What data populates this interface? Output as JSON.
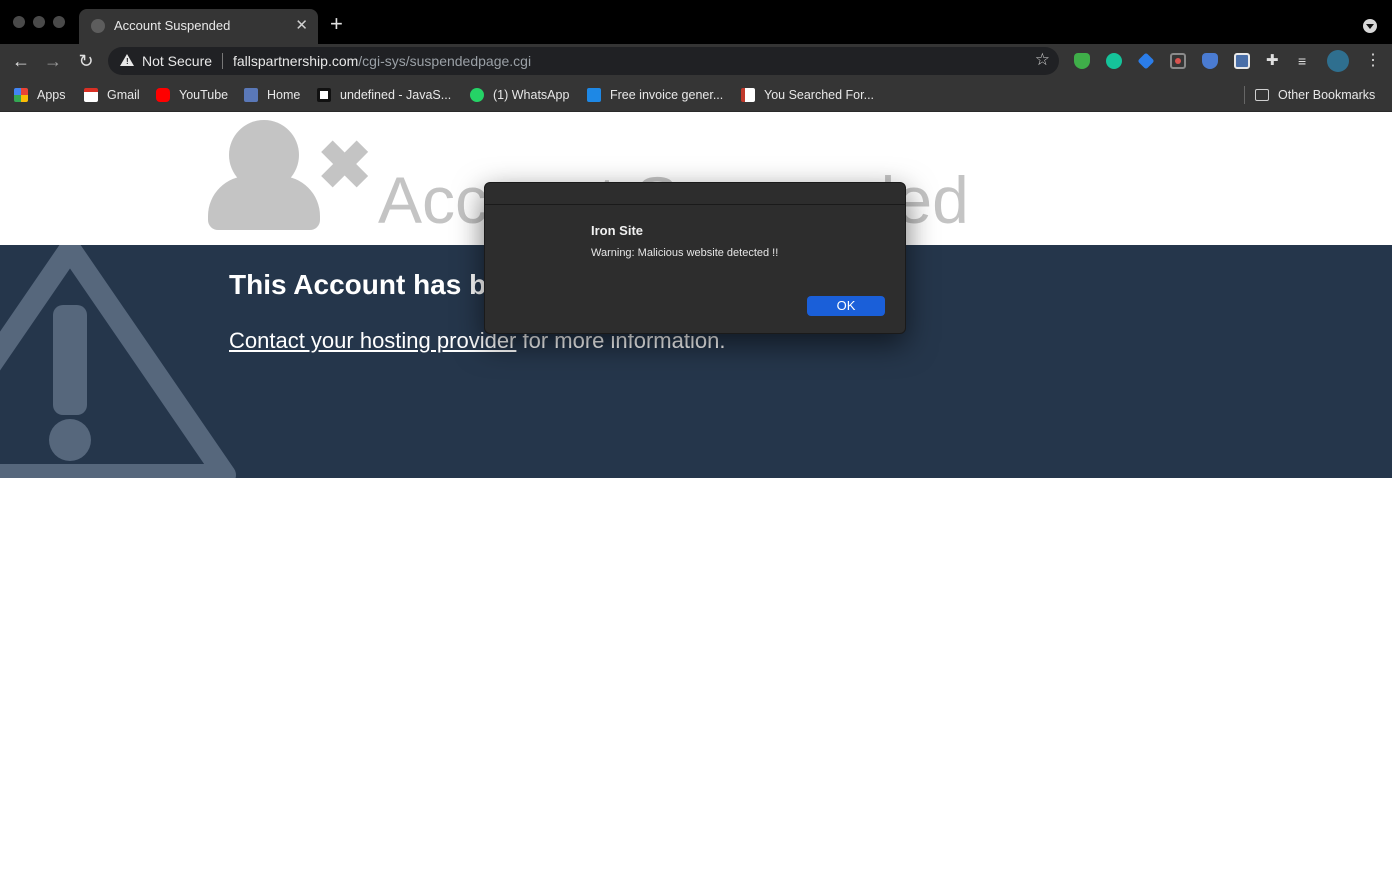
{
  "browser": {
    "tab": {
      "title": "Account Suspended",
      "close": "✕"
    },
    "new_tab": "+",
    "nav": {
      "back": "←",
      "forward": "→",
      "reload": "↻"
    },
    "address": {
      "security_label": "Not Secure",
      "host": "fallspartnership.com",
      "path": "/cgi-sys/suspendedpage.cgi"
    },
    "bookmark_star": "☆",
    "menu": "⋮",
    "extensions": [
      {
        "name": "shield-extension-icon",
        "color": "#3fae49"
      },
      {
        "name": "grammarly-extension-icon",
        "color": "#15c39a"
      },
      {
        "name": "puzzle-blue-extension-icon",
        "color": "#2b7de9"
      },
      {
        "name": "screen-record-extension-icon",
        "color": "#d9534f"
      },
      {
        "name": "blue-shield-extension-icon",
        "color": "#4a7bd1"
      },
      {
        "name": "security-extension-icon",
        "color": "#e8e8e8"
      },
      {
        "name": "extensions-puzzle-icon",
        "color": "#e0e0e0"
      },
      {
        "name": "media-queue-icon",
        "color": "#e0e0e0"
      },
      {
        "name": "profile-avatar",
        "color": "#2f6f8f"
      }
    ],
    "bookmarks": [
      {
        "label": "Apps",
        "icon": "apps-grid-icon",
        "color": "#ea4335"
      },
      {
        "label": "Gmail",
        "icon": "gmail-icon",
        "color": "#d93025"
      },
      {
        "label": "YouTube",
        "icon": "youtube-icon",
        "color": "#ff0000"
      },
      {
        "label": "Home",
        "icon": "home-icon",
        "color": "#5a78b8"
      },
      {
        "label": "undefined - JavaS...",
        "icon": "javascript-icon",
        "color": "#111111"
      },
      {
        "label": "(1) WhatsApp",
        "icon": "whatsapp-icon",
        "color": "#25d366"
      },
      {
        "label": "Free invoice gener...",
        "icon": "invoice-icon",
        "color": "#1e88e5"
      },
      {
        "label": "You Searched For...",
        "icon": "search-result-icon",
        "color": "#ffffff"
      }
    ],
    "other_bookmarks": "Other Bookmarks"
  },
  "page": {
    "hero_title": "Account Suspended",
    "band_title": "This Account has been suspended.",
    "contact_link": "Contact your hosting provider",
    "contact_rest": " for more information."
  },
  "dialog": {
    "title": "Iron Site",
    "message": "Warning: Malicious website detected !!",
    "ok": "OK"
  }
}
